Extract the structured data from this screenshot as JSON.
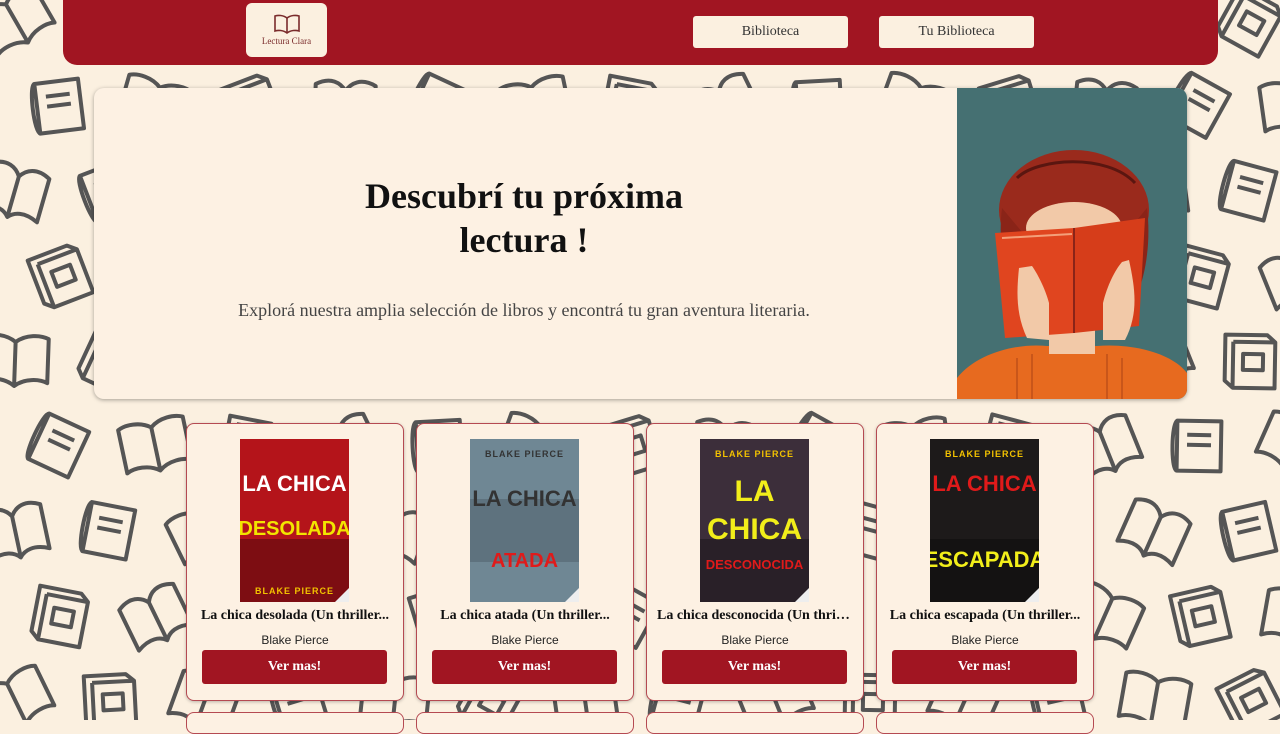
{
  "brand": {
    "name": "Lectura Clara"
  },
  "nav": {
    "items": [
      {
        "label": "Biblioteca"
      },
      {
        "label": "Tu Biblioteca"
      }
    ]
  },
  "hero": {
    "title_line1": "Descubrí tu próxima",
    "title_line2": "lectura !",
    "subtitle": "Explorá nuestra amplia selección de libros y encontrá tu gran aventura literaria."
  },
  "books": [
    {
      "title": "La chica desolada (Un thriller...",
      "author": "Blake Pierce",
      "button": "Ver mas!",
      "cover": {
        "author": "BLAKE PIERCE",
        "line1": "LA CHICA",
        "line2": "DESOLADA",
        "bg": "#b4141a",
        "line1_color": "#ffffff",
        "line2_color": "#f2e500",
        "author_color": "#f2c200"
      }
    },
    {
      "title": "La chica atada (Un thriller...",
      "author": "Blake Pierce",
      "button": "Ver mas!",
      "cover": {
        "author": "BLAKE PIERCE",
        "line1": "LA CHICA",
        "line2": "ATADA",
        "bg": "#6f8794",
        "line1_color": "#333333",
        "line2_color": "#e01a1a",
        "author_color": "#333333"
      }
    },
    {
      "title": "La chica desconocida (Un thriller...",
      "author": "Blake Pierce",
      "button": "Ver mas!",
      "cover": {
        "author": "BLAKE PIERCE",
        "line1": "LA",
        "line1b": "CHICA",
        "line2": "DESCONOCIDA",
        "bg": "#3c2e3a",
        "line1_color": "#f2ee1a",
        "line2_color": "#e01a1a",
        "author_color": "#f2c200"
      }
    },
    {
      "title": "La chica escapada (Un thriller...",
      "author": "Blake Pierce",
      "button": "Ver mas!",
      "cover": {
        "author": "BLAKE PIERCE",
        "line1": "LA CHICA",
        "line2": "ESCAPADA",
        "bg": "#1d1a1a",
        "line1_color": "#e01a1a",
        "line2_color": "#f2ee1a",
        "author_color": "#f2c200"
      }
    }
  ],
  "colors": {
    "primary": "#a11522",
    "background": "#fbf0e0",
    "card_bg": "#fdf1e3",
    "pattern": "#555555"
  }
}
